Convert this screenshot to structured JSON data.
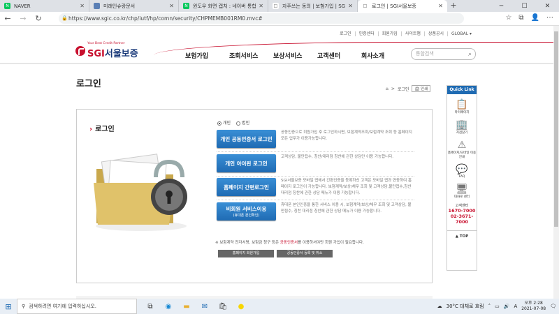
{
  "browser": {
    "tabs": [
      {
        "title": "NAVER",
        "fav_color": "#03c75a",
        "fav_glyph": "N"
      },
      {
        "title": "미래인슈랑문서",
        "fav_color": "#5a7fb5",
        "fav_glyph": ""
      },
      {
        "title": "윈도우 화면 캡처 : 네이버 통합검",
        "fav_color": "#03c75a",
        "fav_glyph": "N"
      },
      {
        "title": "자주쓰는 동의 | 보험가입 | SGI서",
        "fav_color": "#ffffff",
        "fav_glyph": "□"
      },
      {
        "title": "로그인 | SGI서울보증",
        "fav_color": "#ffffff",
        "fav_glyph": "□"
      }
    ],
    "url": "https://www.sgic.co.kr/chp/iutf/hp/comn/security/CHPMEMB001RM0.mvc#"
  },
  "site": {
    "util_links": [
      "로그인",
      "인증센터",
      "회원가입",
      "사이트맵",
      "상품공시",
      "GLOBAL ▾"
    ],
    "logo_tagline": "Your Best Credit Partner",
    "logo_brand": "SGI",
    "logo_name": "서울보증",
    "main_nav": [
      "보험가입",
      "조회서비스",
      "보상서비스",
      "고객센터",
      "회사소개"
    ],
    "search_placeholder": "통합검색"
  },
  "page": {
    "title": "로그인",
    "breadcrumb_current": "로그인",
    "print_label": "인쇄",
    "section_heading": "로그인",
    "radio_personal": "개인",
    "radio_corporate": "법인",
    "options": [
      {
        "label": "개인 공동인증서 로그인",
        "sub": "",
        "desc": "공동인증으로 회원가입 후 로그인하시면, 보험계약조회/보험계약 조회 등 홈페이지 모든 업무가 이용가능합니다."
      },
      {
        "label": "개인 아이핀 로그인",
        "sub": "",
        "desc": "고객상담, 불만접수, 칭찬/대리점 칭찬에 관한 상담만 이용 가능합니다."
      },
      {
        "label": "홈페이지 간편로그인",
        "sub": "",
        "desc": "SGI서울보증 모바일 앱에서 간편인증을 등록하신 고객은 모바일 앱과 연동하여 홈페이지 로그인이 가능합니다. 보험계약/보상/채무 조회 및 고객상담,불만접수,칭찬 대리점 칭찬에 관한 상담 메뉴가 이용 가능합니다."
      },
      {
        "label": "비회원 서비스이용",
        "sub": "(휴대폰 본인확인)",
        "desc": "휴대폰 본인인증을 통한 서비스 이용 시, 보험계약/보상/채무 조회 및 고객상담, 불만접수, 칭찬 대리점 칭찬에 관한 상담 메뉴가 이용 가능합니다."
      }
    ],
    "note_prefix": "※ 보험계약 전자서명, 보험금 청구 등은",
    "note_highlight": "공동인증서",
    "note_suffix": "를 이용하셔야만 회원 가입이 필요합니다.",
    "gray_buttons": [
      "홈페이지 회원가입",
      "공동인증서 등록 및 취소"
    ]
  },
  "quick_link": {
    "header": "Quick Link",
    "items": [
      {
        "label": "마이페이지",
        "icon": "clipboard-icon",
        "glyph": "📋"
      },
      {
        "label": "지점찾기",
        "icon": "building-icon",
        "glyph": "🏢"
      },
      {
        "label": "홈페이지/모바일 이용안내",
        "icon": "warning-icon",
        "glyph": "⚠"
      },
      {
        "label": "FAQ",
        "icon": "chat-icon",
        "glyph": "💬"
      },
      {
        "label": "대화로 센터",
        "icon": "monitor-icon",
        "glyph": "🖥"
      }
    ],
    "tel_label": "고객센터",
    "tel1": "1670-7000",
    "tel2": "02-3671-7000",
    "top_label": "▲ TOP"
  },
  "taskbar": {
    "search_placeholder": "검색하려면 여기에 입력하십시오.",
    "weather": "30°C 대체로 흐림",
    "ime": "A",
    "time": "오후 2:28",
    "date": "2021-07-08"
  }
}
